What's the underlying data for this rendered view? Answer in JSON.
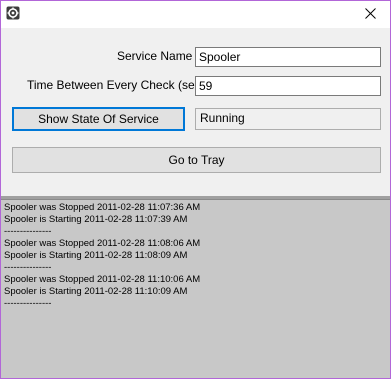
{
  "titlebar": {
    "app_icon": "gear-icon",
    "close_icon": "close-icon"
  },
  "form": {
    "service_name_label": "Service Name",
    "service_name_value": "Spooler",
    "interval_label": "Time Between Every Check (sec)",
    "interval_value": "59",
    "show_state_button": "Show State Of Service",
    "state_value": "Running",
    "tray_button": "Go to Tray"
  },
  "log": {
    "lines": [
      "Spooler was Stopped 2011-02-28 11:07:36 AM",
      "Spooler is Starting 2011-02-28 11:07:39 AM",
      "---------------",
      "Spooler was Stopped 2011-02-28 11:08:06 AM",
      "Spooler is Starting 2011-02-28 11:08:09 AM",
      "---------------",
      "Spooler was Stopped 2011-02-28 11:10:06 AM",
      "Spooler is Starting 2011-02-28 11:10:09 AM",
      "---------------"
    ]
  },
  "colors": {
    "window_border": "#b266d8",
    "focus_border": "#0078d7",
    "client_bg": "#f0f0f0",
    "log_bg": "#c8c8c8"
  }
}
